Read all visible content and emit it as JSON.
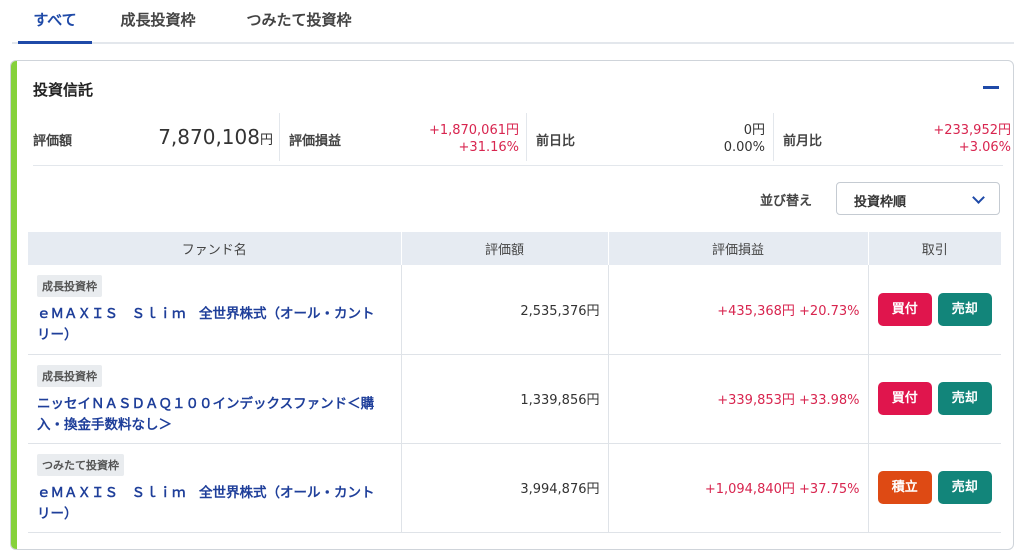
{
  "tabs": [
    {
      "label": "すべて",
      "active": true
    },
    {
      "label": "成長投資枠",
      "active": false
    },
    {
      "label": "つみたて投資枠",
      "active": false
    }
  ],
  "section": {
    "title": "投資信託"
  },
  "summary": {
    "valuation_label": "評価額",
    "valuation_value": "7,870,108",
    "valuation_unit": "円",
    "pl_label": "評価損益",
    "pl_amount": "+1,870,061円",
    "pl_percent": "+31.16%",
    "day_label": "前日比",
    "day_amount": "0円",
    "day_percent": "0.00%",
    "month_label": "前月比",
    "month_amount": "+233,952円",
    "month_percent": "+3.06%"
  },
  "sort": {
    "label": "並び替え",
    "value": "投資枠順"
  },
  "table": {
    "headers": [
      "ファンド名",
      "評価額",
      "評価損益",
      "取引"
    ],
    "rows": [
      {
        "badge": "成長投資枠",
        "name": "ｅＭＡＸＩＳ　Ｓｌｉｍ　全世界株式（オール・カントリー）",
        "value": "2,535,376円",
        "pl": "+435,368円",
        "pl_pct": "+20.73%",
        "action": "買付",
        "sell": "売却"
      },
      {
        "badge": "成長投資枠",
        "name": "ニッセイＮＡＳＤＡＱ１００インデックスファンド＜購入・換金手数料なし＞",
        "value": "1,339,856円",
        "pl": "+339,853円",
        "pl_pct": "+33.98%",
        "action": "買付",
        "sell": "売却"
      },
      {
        "badge": "つみたて投資枠",
        "name": "ｅＭＡＸＩＳ　Ｓｌｉｍ　全世界株式（オール・カントリー）",
        "value": "3,994,876円",
        "pl": "+1,094,840円",
        "pl_pct": "+37.75%",
        "action": "積立",
        "sell": "売却"
      }
    ]
  },
  "colors": {
    "accent": "#1f4aa8",
    "positive": "#d8254f",
    "buy": "#e0154d",
    "accumulate": "#de4a14",
    "sell": "#12857a",
    "card_bar": "#86d13b"
  },
  "icons": {
    "collapse": "minus-icon",
    "sort": "chevron-down-icon"
  }
}
